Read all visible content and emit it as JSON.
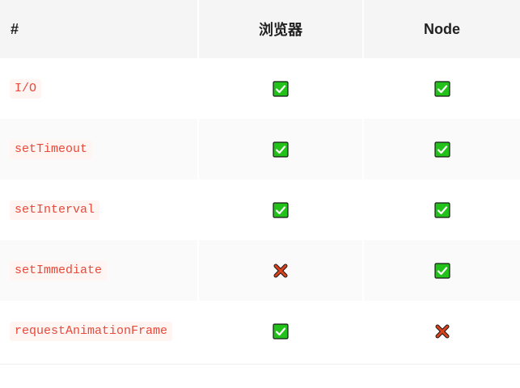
{
  "table": {
    "headers": [
      "#",
      "浏览器",
      "Node"
    ],
    "rows": [
      {
        "name": "I/O",
        "browser": "check",
        "node": "check"
      },
      {
        "name": "setTimeout",
        "browser": "check",
        "node": "check"
      },
      {
        "name": "setInterval",
        "browser": "check",
        "node": "check"
      },
      {
        "name": "setImmediate",
        "browser": "cross",
        "node": "check"
      },
      {
        "name": "requestAnimationFrame",
        "browser": "check",
        "node": "cross"
      }
    ]
  },
  "icons": {
    "check": "check-mark-button-icon",
    "cross": "cross-mark-icon"
  },
  "colors": {
    "code_text": "#e8493a",
    "check_fill": "#22c21a",
    "cross_fill": "#d9421c"
  }
}
